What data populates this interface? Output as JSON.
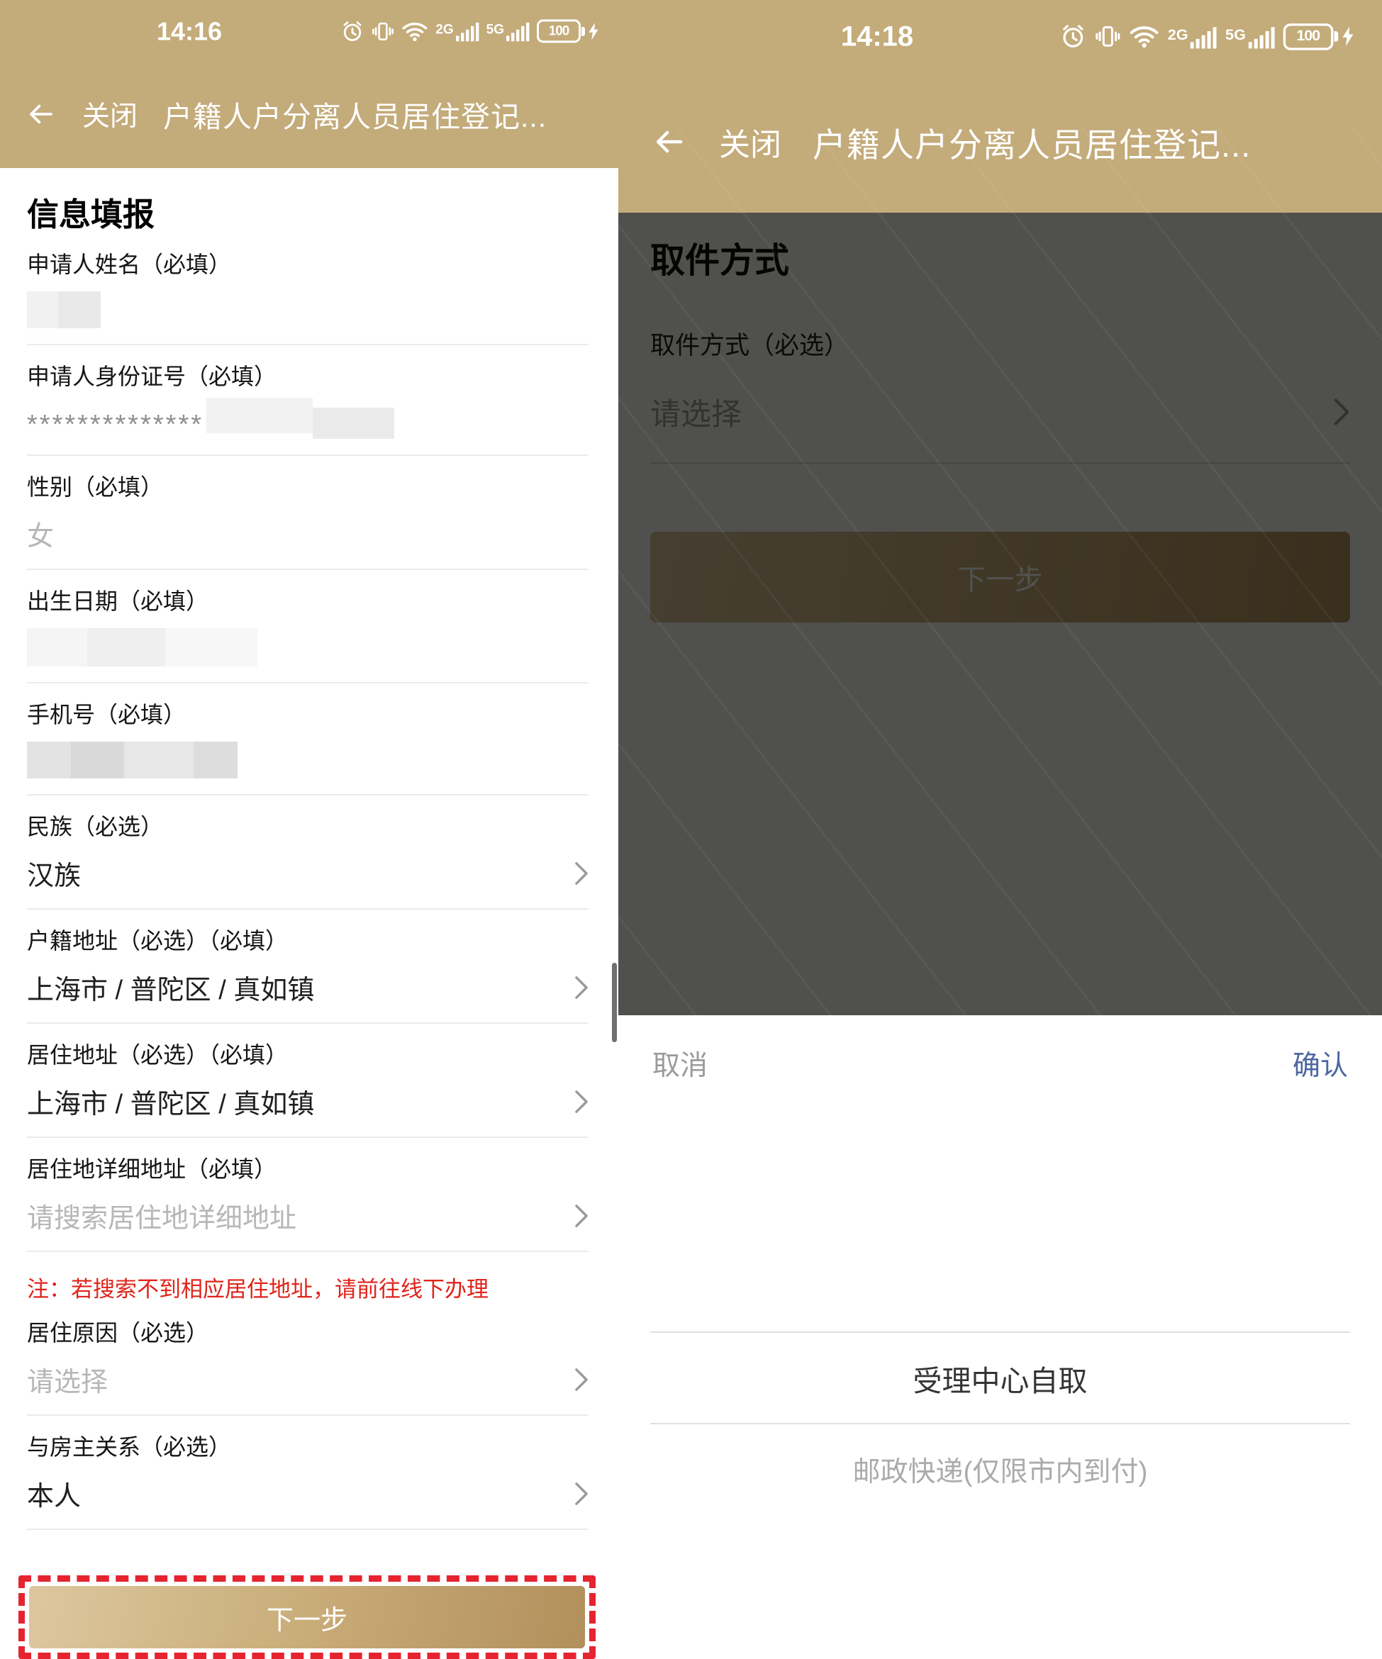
{
  "colors": {
    "header_gold": "#c3ab7a",
    "button_gradient_start": "#ddc79f",
    "button_gradient_end": "#b2905c",
    "note_red": "#e0241b",
    "highlight_dash_red": "#e52430",
    "confirm_blue": "#4d67a0",
    "placeholder_gray": "#b7b7b7"
  },
  "left": {
    "status": {
      "time": "14:16",
      "net_a": "2G",
      "net_b": "5G",
      "battery": "100"
    },
    "header": {
      "close": "关闭",
      "title": "户籍人户分离人员居住登记..."
    },
    "section_title": "信息填报",
    "fields": [
      {
        "label": "申请人姓名（必填）"
      },
      {
        "label": "申请人身份证号（必填）",
        "value": "**************"
      },
      {
        "label": "性别（必填）",
        "value": "女"
      },
      {
        "label": "出生日期（必填）"
      },
      {
        "label": "手机号（必填）"
      },
      {
        "label": "民族（必选）",
        "value": "汉族"
      },
      {
        "label": "户籍地址（必选）（必填）",
        "value": "上海市 / 普陀区 / 真如镇"
      },
      {
        "label": "居住地址（必选）（必填）",
        "value": "上海市 / 普陀区 / 真如镇"
      },
      {
        "label": "居住地详细地址（必填）",
        "placeholder": "请搜索居住地详细地址"
      },
      {
        "label": "居住原因（必选）",
        "placeholder": "请选择"
      },
      {
        "label": "与房主关系（必选）",
        "value": "本人"
      }
    ],
    "note": "注：若搜索不到相应居住地址，请前往线下办理",
    "next_button": "下一步"
  },
  "right": {
    "status": {
      "time": "14:18",
      "net_a": "2G",
      "net_b": "5G",
      "battery": "100"
    },
    "header": {
      "close": "关闭",
      "title": "户籍人户分离人员居住登记..."
    },
    "section_title": "取件方式",
    "field": {
      "label": "取件方式（必选）",
      "placeholder": "请选择"
    },
    "next_button": "下一步",
    "picker": {
      "cancel": "取消",
      "confirm": "确认",
      "options": [
        "受理中心自取",
        "邮政快递(仅限市内到付)"
      ],
      "selected": "受理中心自取"
    }
  }
}
